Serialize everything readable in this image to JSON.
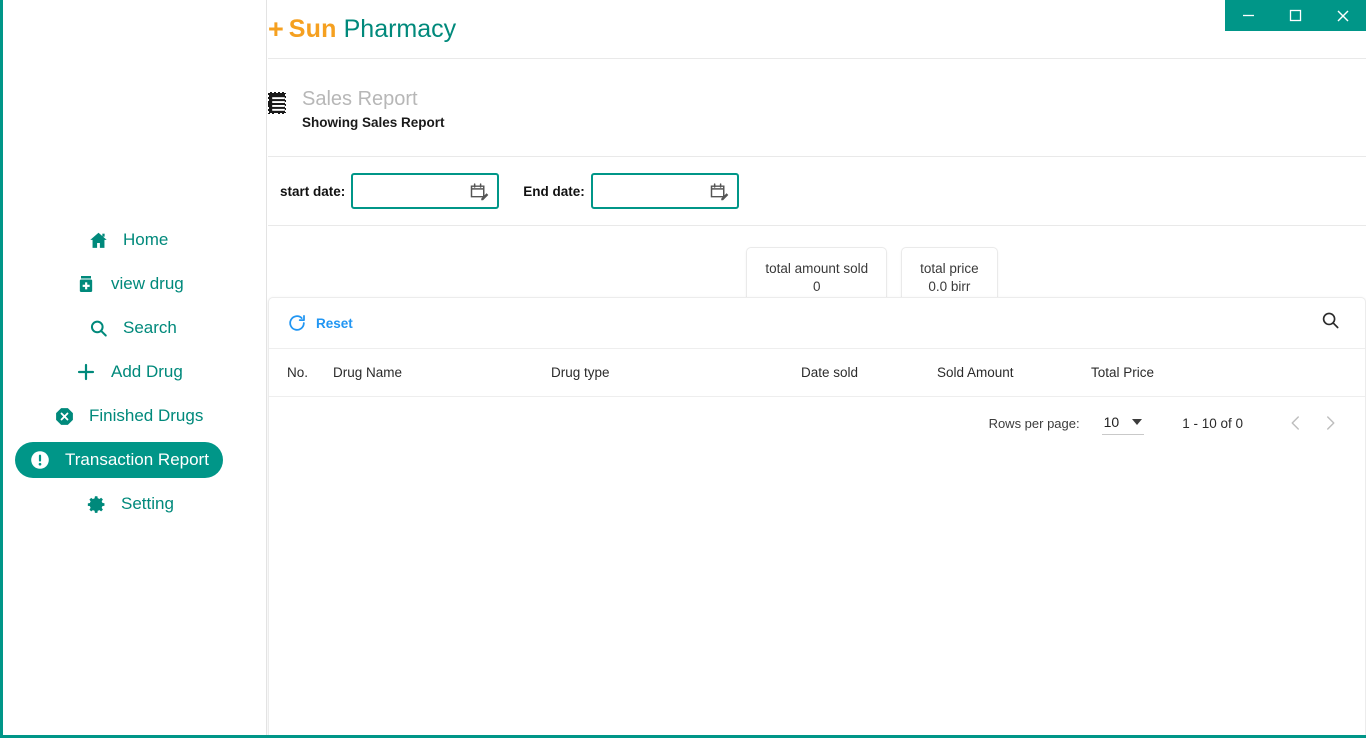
{
  "window_controls": {
    "minimize_label": "minimize",
    "maximize_label": "maximize",
    "close_label": "close"
  },
  "brand": {
    "plus": "+",
    "name": "Sun",
    "suffix": "Pharmacy",
    "accent_color": "#f5a020",
    "teal_color": "#009688"
  },
  "sidebar": {
    "items": [
      {
        "label": "Home",
        "icon": "home-icon",
        "active": false
      },
      {
        "label": "view drug",
        "icon": "medicine-bottle-icon",
        "active": false
      },
      {
        "label": "Search",
        "icon": "search-icon",
        "active": false
      },
      {
        "label": "Add Drug",
        "icon": "plus-icon",
        "active": false
      },
      {
        "label": "Finished Drugs",
        "icon": "x-octagon-icon",
        "active": false
      },
      {
        "label": "Transaction Report",
        "icon": "exclamation-circle-icon",
        "active": true
      },
      {
        "label": "Setting",
        "icon": "gear-icon",
        "active": false
      }
    ]
  },
  "report": {
    "icon": "receipt-icon",
    "title": "Sales Report",
    "subtitle": "Showing Sales Report"
  },
  "filters": {
    "start_date_label": "start date:",
    "start_date_value": "",
    "start_date_placeholder": "",
    "end_date_label": "End date:",
    "end_date_value": "",
    "end_date_placeholder": "",
    "calendar_icon": "calendar-edit-icon"
  },
  "stats": [
    {
      "label": "total amount sold",
      "value": "0"
    },
    {
      "label": "total price",
      "value": "0.0 birr"
    }
  ],
  "table": {
    "reset_label": "Reset",
    "reset_icon": "refresh-icon",
    "search_icon": "search-icon",
    "columns": [
      "No.",
      "Drug Name",
      "Drug type",
      "Date sold",
      "Sold Amount",
      "Total Price"
    ],
    "rows": []
  },
  "pagination": {
    "rows_per_page_label": "Rows per page:",
    "rows_per_page_value": "10",
    "range_label": "1 - 10 of 0",
    "prev_icon": "chevron-left-icon",
    "next_icon": "chevron-right-icon"
  }
}
